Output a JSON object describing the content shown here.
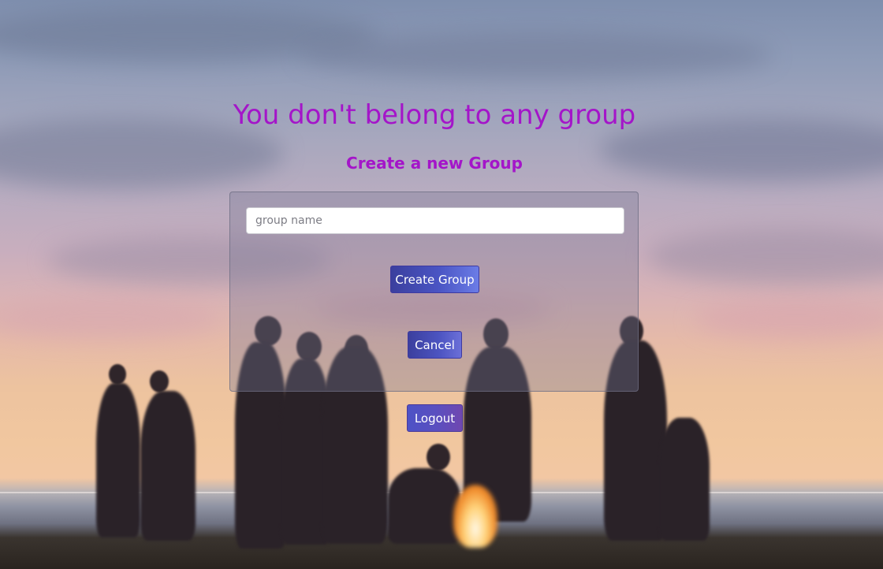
{
  "heading": "You don't belong to any group",
  "subheading": "Create a new Group",
  "form": {
    "group_name_placeholder": "group name",
    "group_name_value": "",
    "create_label": "Create Group",
    "cancel_label": "Cancel"
  },
  "logout_label": "Logout",
  "colors": {
    "heading": "#a415c9",
    "button_start": "#3b3f9e",
    "button_end": "#6b7ce6"
  }
}
